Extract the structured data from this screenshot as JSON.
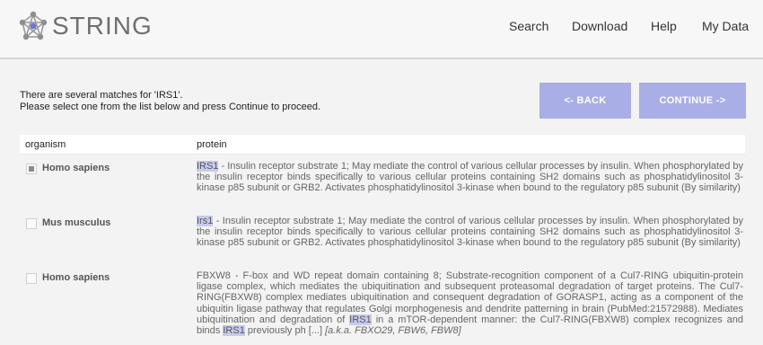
{
  "header": {
    "logo_text": "STRING",
    "nav": [
      "Search",
      "Download",
      "Help",
      "My Data"
    ]
  },
  "message": {
    "line1": "There are several matches for 'IRS1'.",
    "line2": "Please select one from the list below and press Continue to proceed."
  },
  "buttons": {
    "back": "<- BACK",
    "continue": "CONTINUE ->"
  },
  "table": {
    "col_organism": "organism",
    "col_protein": "protein",
    "rows": [
      {
        "checked": true,
        "organism": "Homo sapiens",
        "hit": "IRS1",
        "text": " - Insulin receptor substrate 1; May mediate the control of various cellular processes by insulin. When phosphorylated by the insulin receptor binds specifically to various cellular proteins containing SH2 domains such as phosphatidylinositol 3-kinase p85 subunit or GRB2. Activates phosphatidylinositol 3-kinase when bound to the regulatory p85 subunit (By similarity)"
      },
      {
        "checked": false,
        "organism": "Mus musculus",
        "hit": "Irs1",
        "text": " - Insulin receptor substrate 1; May mediate the control of various cellular processes by insulin. When phosphorylated by the insulin receptor binds specifically to various cellular proteins containing SH2 domains such as phosphatidylinositol 3-kinase p85 subunit or GRB2. Activates phosphatidylinositol 3-kinase when bound to the regulatory p85 subunit (By similarity)"
      },
      {
        "checked": false,
        "organism": "Homo sapiens",
        "text_a": "FBXW8 - F-box and WD repeat domain containing 8; Substrate-recognition component of a Cul7-RING ubiquitin-protein ligase complex, which mediates the ubiquitination and subsequent proteasomal degradation of target proteins. The Cul7-RING(FBXW8) complex mediates ubiquitination and consequent degradation of GORASP1, acting as a component of the ubiquitin ligase pathway that regulates Golgi morphogenesis and dendrite patterning in brain (PubMed:21572988). Mediates ubiquitination and degradation of ",
        "hit_a": "IRS1",
        "text_b": " in a mTOR-dependent manner: the Cul7-RING(FBXW8) complex recognizes and binds ",
        "hit_b": "IRS1",
        "text_c": " previously ph [...] ",
        "aka": "[a.k.a. FBXO29, FBW6, FBW8]"
      }
    ]
  }
}
